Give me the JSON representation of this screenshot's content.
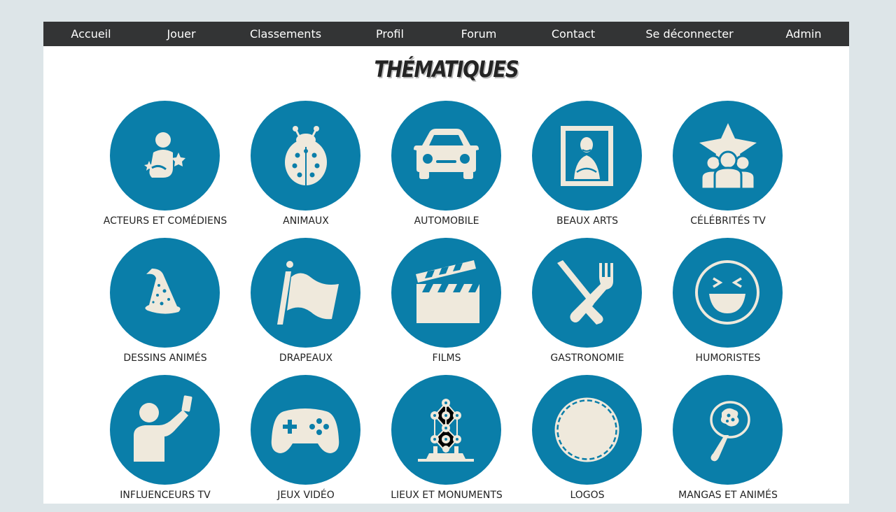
{
  "nav": {
    "items": [
      "Accueil",
      "Jouer",
      "Classements",
      "Profil",
      "Forum",
      "Contact",
      "Se déconnecter",
      "Admin"
    ]
  },
  "page": {
    "title": "THÉMATIQUES"
  },
  "colors": {
    "circle": "#0a7ea9",
    "icon": "#efe9dc",
    "nav_bg": "#333435",
    "background": "#dde5e8"
  },
  "themes": [
    {
      "label": "ACTEURS ET COMÉDIENS",
      "icon": "actor-icon"
    },
    {
      "label": "ANIMAUX",
      "icon": "ladybug-icon"
    },
    {
      "label": "AUTOMOBILE",
      "icon": "car-icon"
    },
    {
      "label": "BEAUX ARTS",
      "icon": "mona-lisa-icon"
    },
    {
      "label": "CÉLÉBRITÉS TV",
      "icon": "celebrity-icon"
    },
    {
      "label": "DESSINS ANIMÉS",
      "icon": "wizard-hat-icon"
    },
    {
      "label": "DRAPEAUX",
      "icon": "flag-icon"
    },
    {
      "label": "FILMS",
      "icon": "clapperboard-icon"
    },
    {
      "label": "GASTRONOMIE",
      "icon": "knife-fork-icon"
    },
    {
      "label": "HUMORISTES",
      "icon": "laughing-face-icon"
    },
    {
      "label": "INFLUENCEURS TV",
      "icon": "selfie-icon"
    },
    {
      "label": "JEUX VIDÉO",
      "icon": "gamepad-icon"
    },
    {
      "label": "LIEUX ET MONUMENTS",
      "icon": "atomium-icon"
    },
    {
      "label": "LOGOS",
      "icon": "badge-icon"
    },
    {
      "label": "MANGAS ET ANIMÉS",
      "icon": "fan-icon"
    }
  ]
}
